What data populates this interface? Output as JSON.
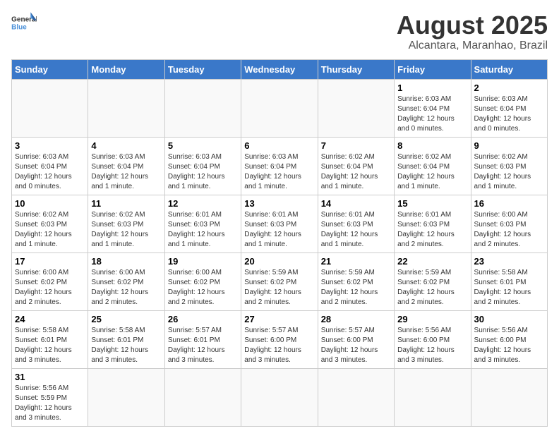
{
  "header": {
    "logo_general": "General",
    "logo_blue": "Blue",
    "title": "August 2025",
    "subtitle": "Alcantara, Maranhao, Brazil"
  },
  "weekdays": [
    "Sunday",
    "Monday",
    "Tuesday",
    "Wednesday",
    "Thursday",
    "Friday",
    "Saturday"
  ],
  "weeks": [
    [
      {
        "day": "",
        "info": ""
      },
      {
        "day": "",
        "info": ""
      },
      {
        "day": "",
        "info": ""
      },
      {
        "day": "",
        "info": ""
      },
      {
        "day": "",
        "info": ""
      },
      {
        "day": "1",
        "info": "Sunrise: 6:03 AM\nSunset: 6:04 PM\nDaylight: 12 hours and 0 minutes."
      },
      {
        "day": "2",
        "info": "Sunrise: 6:03 AM\nSunset: 6:04 PM\nDaylight: 12 hours and 0 minutes."
      }
    ],
    [
      {
        "day": "3",
        "info": "Sunrise: 6:03 AM\nSunset: 6:04 PM\nDaylight: 12 hours and 0 minutes."
      },
      {
        "day": "4",
        "info": "Sunrise: 6:03 AM\nSunset: 6:04 PM\nDaylight: 12 hours and 1 minute."
      },
      {
        "day": "5",
        "info": "Sunrise: 6:03 AM\nSunset: 6:04 PM\nDaylight: 12 hours and 1 minute."
      },
      {
        "day": "6",
        "info": "Sunrise: 6:03 AM\nSunset: 6:04 PM\nDaylight: 12 hours and 1 minute."
      },
      {
        "day": "7",
        "info": "Sunrise: 6:02 AM\nSunset: 6:04 PM\nDaylight: 12 hours and 1 minute."
      },
      {
        "day": "8",
        "info": "Sunrise: 6:02 AM\nSunset: 6:04 PM\nDaylight: 12 hours and 1 minute."
      },
      {
        "day": "9",
        "info": "Sunrise: 6:02 AM\nSunset: 6:03 PM\nDaylight: 12 hours and 1 minute."
      }
    ],
    [
      {
        "day": "10",
        "info": "Sunrise: 6:02 AM\nSunset: 6:03 PM\nDaylight: 12 hours and 1 minute."
      },
      {
        "day": "11",
        "info": "Sunrise: 6:02 AM\nSunset: 6:03 PM\nDaylight: 12 hours and 1 minute."
      },
      {
        "day": "12",
        "info": "Sunrise: 6:01 AM\nSunset: 6:03 PM\nDaylight: 12 hours and 1 minute."
      },
      {
        "day": "13",
        "info": "Sunrise: 6:01 AM\nSunset: 6:03 PM\nDaylight: 12 hours and 1 minute."
      },
      {
        "day": "14",
        "info": "Sunrise: 6:01 AM\nSunset: 6:03 PM\nDaylight: 12 hours and 1 minute."
      },
      {
        "day": "15",
        "info": "Sunrise: 6:01 AM\nSunset: 6:03 PM\nDaylight: 12 hours and 2 minutes."
      },
      {
        "day": "16",
        "info": "Sunrise: 6:00 AM\nSunset: 6:03 PM\nDaylight: 12 hours and 2 minutes."
      }
    ],
    [
      {
        "day": "17",
        "info": "Sunrise: 6:00 AM\nSunset: 6:02 PM\nDaylight: 12 hours and 2 minutes."
      },
      {
        "day": "18",
        "info": "Sunrise: 6:00 AM\nSunset: 6:02 PM\nDaylight: 12 hours and 2 minutes."
      },
      {
        "day": "19",
        "info": "Sunrise: 6:00 AM\nSunset: 6:02 PM\nDaylight: 12 hours and 2 minutes."
      },
      {
        "day": "20",
        "info": "Sunrise: 5:59 AM\nSunset: 6:02 PM\nDaylight: 12 hours and 2 minutes."
      },
      {
        "day": "21",
        "info": "Sunrise: 5:59 AM\nSunset: 6:02 PM\nDaylight: 12 hours and 2 minutes."
      },
      {
        "day": "22",
        "info": "Sunrise: 5:59 AM\nSunset: 6:02 PM\nDaylight: 12 hours and 2 minutes."
      },
      {
        "day": "23",
        "info": "Sunrise: 5:58 AM\nSunset: 6:01 PM\nDaylight: 12 hours and 2 minutes."
      }
    ],
    [
      {
        "day": "24",
        "info": "Sunrise: 5:58 AM\nSunset: 6:01 PM\nDaylight: 12 hours and 3 minutes."
      },
      {
        "day": "25",
        "info": "Sunrise: 5:58 AM\nSunset: 6:01 PM\nDaylight: 12 hours and 3 minutes."
      },
      {
        "day": "26",
        "info": "Sunrise: 5:57 AM\nSunset: 6:01 PM\nDaylight: 12 hours and 3 minutes."
      },
      {
        "day": "27",
        "info": "Sunrise: 5:57 AM\nSunset: 6:00 PM\nDaylight: 12 hours and 3 minutes."
      },
      {
        "day": "28",
        "info": "Sunrise: 5:57 AM\nSunset: 6:00 PM\nDaylight: 12 hours and 3 minutes."
      },
      {
        "day": "29",
        "info": "Sunrise: 5:56 AM\nSunset: 6:00 PM\nDaylight: 12 hours and 3 minutes."
      },
      {
        "day": "30",
        "info": "Sunrise: 5:56 AM\nSunset: 6:00 PM\nDaylight: 12 hours and 3 minutes."
      }
    ],
    [
      {
        "day": "31",
        "info": "Sunrise: 5:56 AM\nSunset: 5:59 PM\nDaylight: 12 hours and 3 minutes."
      },
      {
        "day": "",
        "info": ""
      },
      {
        "day": "",
        "info": ""
      },
      {
        "day": "",
        "info": ""
      },
      {
        "day": "",
        "info": ""
      },
      {
        "day": "",
        "info": ""
      },
      {
        "day": "",
        "info": ""
      }
    ]
  ]
}
